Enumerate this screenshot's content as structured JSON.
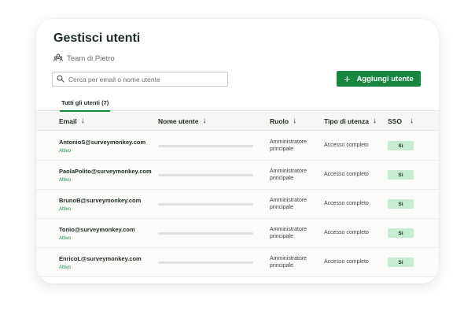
{
  "header": {
    "title": "Gestisci utenti",
    "team_name": "Team di Pietro"
  },
  "search": {
    "placeholder": "Cerca per email o nome utente"
  },
  "actions": {
    "add_user_label": "Aggiungi utente",
    "add_icon": "plus-icon"
  },
  "tabs": [
    {
      "label": "Tutti gli utenti (7)",
      "active": true
    }
  ],
  "table": {
    "columns": [
      "Email",
      "Nome utente",
      "Ruolo",
      "Tipo di utenza",
      "SSO"
    ],
    "rows": [
      {
        "email": "AntonioS@surveymonkey.com",
        "status": "Attivo",
        "role": "Amministratore principale",
        "account_type": "Accesso completo",
        "sso": "Sì"
      },
      {
        "email": "PaolaPolito@surveymonkey.com",
        "status": "Attivo",
        "role": "Amministratore principale",
        "account_type": "Accesso completo",
        "sso": "Sì"
      },
      {
        "email": "BrunoB@surveymonkey.com",
        "status": "Attivo",
        "role": "Amministratore principale",
        "account_type": "Accesso completo",
        "sso": "Sì"
      },
      {
        "email": "Tonio@surveymonkey.com",
        "status": "Attivo",
        "role": "Amministratore principale",
        "account_type": "Accesso completo",
        "sso": "Sì"
      },
      {
        "email": "EnricoL@surveymonkey.com",
        "status": "Attivo",
        "role": "Amministratore principale",
        "account_type": "Accesso completo",
        "sso": "Sì"
      }
    ]
  },
  "colors": {
    "accent": "#17873f",
    "sso_badge": "#c7ecd2",
    "header_bg": "#f6f7f5"
  }
}
